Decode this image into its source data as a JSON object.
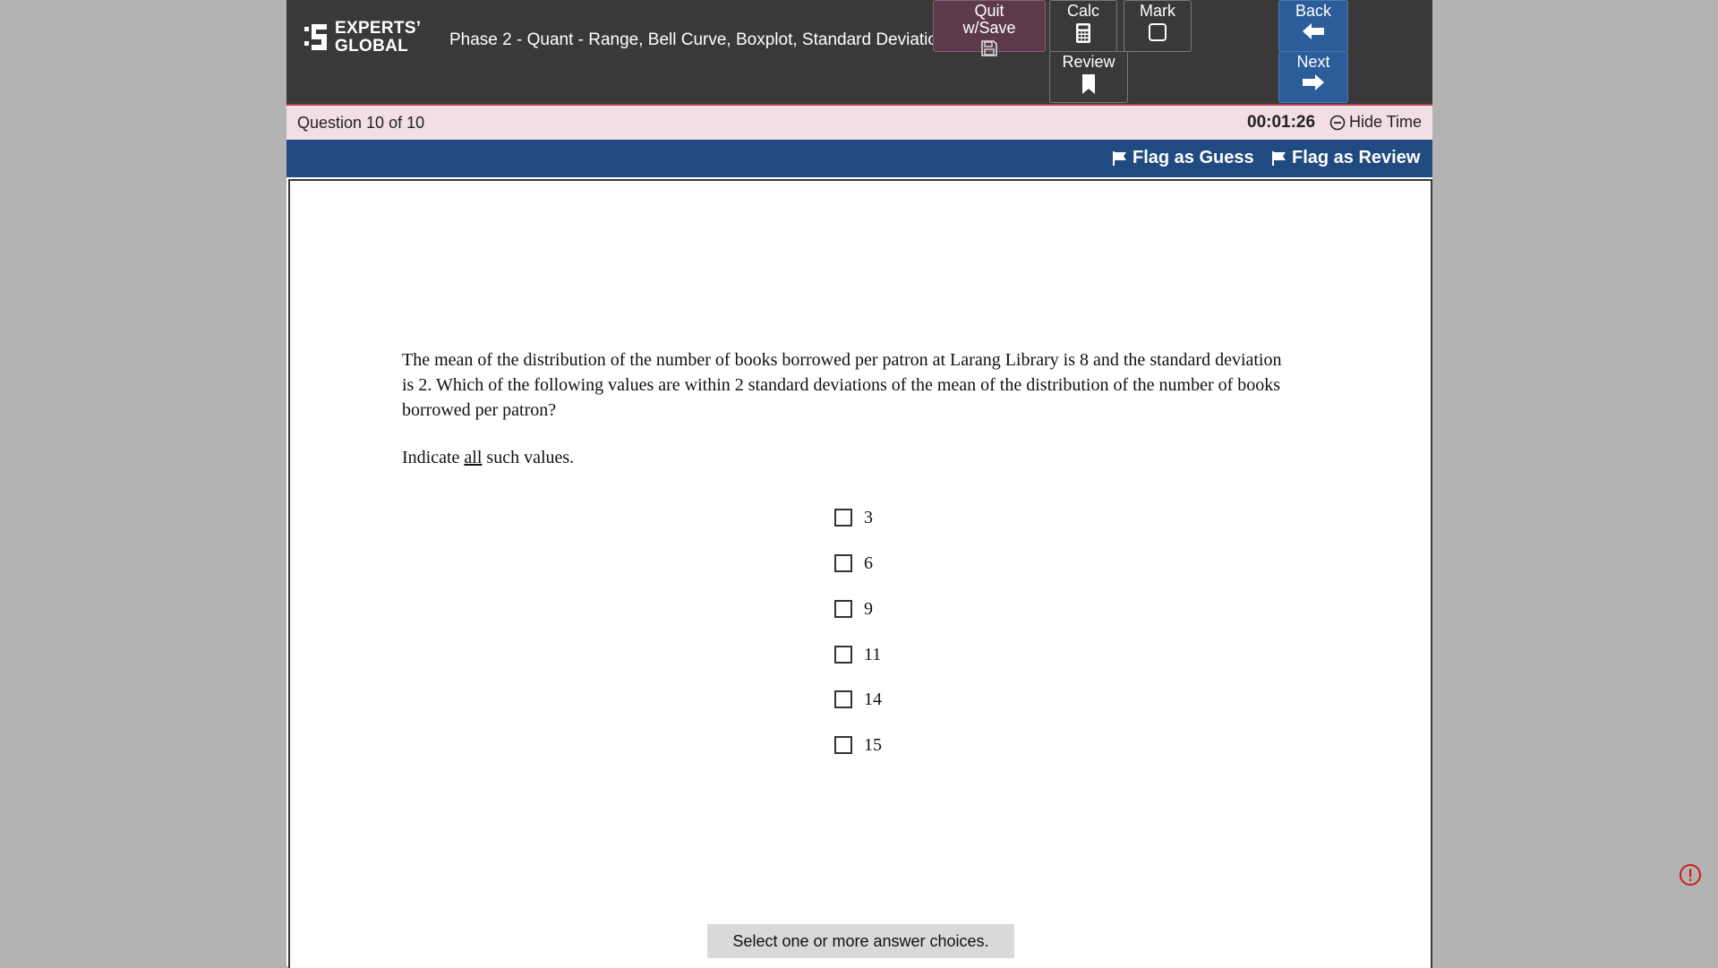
{
  "header": {
    "logo_line1": "EXPERTS’",
    "logo_line2": "GLOBAL",
    "section_title": "Phase 2 - Quant - Range, Bell Curve, Boxplot, Standard Deviation"
  },
  "toolbar": {
    "quit_label": "Quit w/Save",
    "calc_label": "Calc",
    "mark_label": "Mark",
    "review_label": "Review",
    "back_label": "Back",
    "next_label": "Next"
  },
  "status": {
    "question_counter": "Question 10 of 10",
    "timer": "00:01:26",
    "hide_time_label": "Hide Time"
  },
  "flags": {
    "guess_label": "Flag as Guess",
    "review_label": "Flag as Review"
  },
  "question": {
    "text": "The mean of the distribution of the number of books borrowed per patron at Larang Library is 8 and the standard deviation is 2. Which of the following values are within 2 standard deviations of the mean of the distribution of the number of books borrowed per patron?",
    "instruction_prefix": "Indicate ",
    "instruction_emphasis": "all",
    "instruction_suffix": " such values.",
    "choices": [
      "3",
      "6",
      "9",
      "11",
      "14",
      "15"
    ],
    "hint": "Select one or more answer choices."
  },
  "colors": {
    "header_bg": "#3a3838",
    "status_bg": "#f2dfe3",
    "flag_bar_bg": "#204a80",
    "nav_button_bg": "#2b5d9b",
    "quit_button_bg": "#5c3a4c",
    "alert_red": "#d01c1c"
  },
  "icons": {
    "logo": "experts-global-logo-icon",
    "quit": "floppy-disk-icon",
    "calc": "calculator-icon",
    "mark": "checkbox-icon",
    "review": "bookmark-icon",
    "back": "arrow-left-icon",
    "next": "arrow-right-icon",
    "hide_time": "minus-circle-icon",
    "flag": "flag-icon",
    "alert": "alert-circle-icon"
  }
}
